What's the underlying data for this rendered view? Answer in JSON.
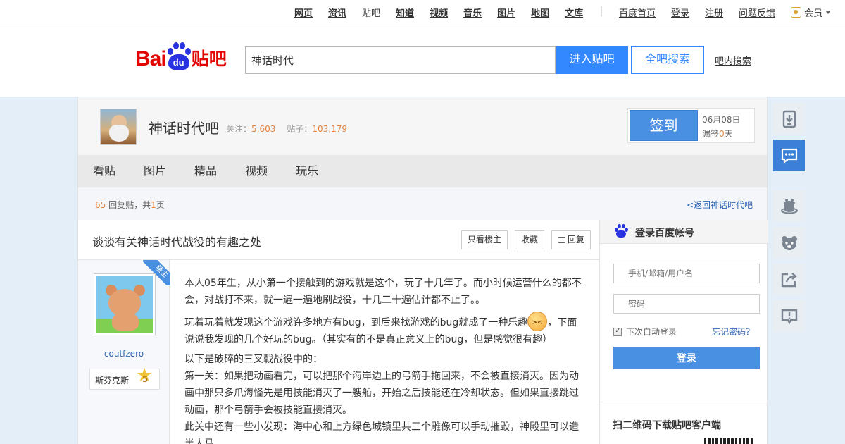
{
  "topnav": {
    "items": [
      {
        "label": "网页",
        "current": false
      },
      {
        "label": "资讯",
        "current": false
      },
      {
        "label": "贴吧",
        "current": true
      },
      {
        "label": "知道",
        "current": false
      },
      {
        "label": "视频",
        "current": false
      },
      {
        "label": "音乐",
        "current": false
      },
      {
        "label": "图片",
        "current": false
      },
      {
        "label": "地图",
        "current": false
      },
      {
        "label": "文库",
        "current": false
      }
    ],
    "links": [
      "百度首页",
      "登录",
      "注册",
      "问题反馈"
    ],
    "member": "会员"
  },
  "header": {
    "logo_text_bai": "Bai",
    "logo_text_du": "du",
    "logo_text_tieba": "贴吧",
    "search_value": "神话时代",
    "enter_button": "进入贴吧",
    "all_search_button": "全吧搜索",
    "in_forum_search": "吧内搜索"
  },
  "forum": {
    "name": "神话时代吧",
    "follow_label": "关注：",
    "follow_count": "5,603",
    "posts_label": "贴子：",
    "posts_count": "103,179",
    "sign_button": "签到",
    "sign_date": "06月08日",
    "miss_prefix": "漏签",
    "miss_days": "0",
    "miss_suffix": "天"
  },
  "tabs": [
    "看贴",
    "图片",
    "精品",
    "视频",
    "玩乐"
  ],
  "thread_bar": {
    "reply_count": "65",
    "reply_text": " 回复贴，共",
    "page_count": "1",
    "page_suffix": "页",
    "back_link": "<返回神话时代吧"
  },
  "post": {
    "title": "谈谈有关神话时代战役的有趣之处",
    "only_op_button": "只看楼主",
    "favorite_button": "收藏",
    "reply_button": "回复",
    "op_badge": "楼主",
    "author": "coutfzero",
    "level_name": "斯芬克斯",
    "level_num": "5",
    "paragraphs": {
      "p1": "本人05年生，从小第一个接触到的游戏就是这个，玩了十几年了。而小时候运营什么的都不会，对战打不来，就一遍一遍地刷战役，十几二十遍估计都不止了。。",
      "p2a": "玩着玩着就发现这个游戏许多地方有bug，到后来找游戏的bug就成了一种乐趣",
      "p2b": "，下面说说我发现的几个好玩的bug。（其实有的不是真正意义上的bug，但是感觉很有趣）",
      "p3": "以下是破碎的三叉戟战役中的：",
      "p4": "第一关：如果把动画看完，可以把那个海岸边上的弓箭手拖回来，不会被直接消灭。因为动画中那只多爪海怪先是用技能消灭了一艘船，开始之后技能还在冷却状态。但如果直接跳过动画，那个弓箭手会被技能直接消灭。",
      "p5": "此关中还有一些小发现：海中心和上方绿色城镇里共三个雕像可以手动摧毁，神殿里可以造半人马"
    }
  },
  "sidebar": {
    "login_title": "登录百度帐号",
    "username_placeholder": "手机/邮箱/用户名",
    "password_placeholder": "密码",
    "remember_label": "下次自动登录",
    "forgot_link": "忘记密码？",
    "login_button": "登录",
    "qr_title": "扫二维码下载贴吧客户端"
  },
  "colors": {
    "accent": "#3388ff",
    "link": "#2d64b3",
    "highlight_number": "#e4833d",
    "brand_red": "#e10602",
    "brand_blue": "#2932e1"
  }
}
